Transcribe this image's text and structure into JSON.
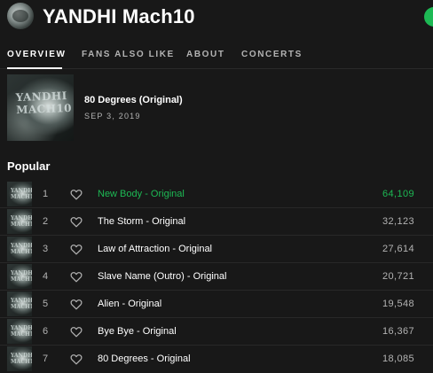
{
  "artist": {
    "name": "YANDHI Mach10",
    "avatar_icon": "artist-avatar"
  },
  "tabs": [
    {
      "label": "OVERVIEW",
      "active": true
    },
    {
      "label": "FANS ALSO LIKE",
      "active": false
    },
    {
      "label": "ABOUT",
      "active": false
    },
    {
      "label": "CONCERTS",
      "active": false
    }
  ],
  "album": {
    "title": "80 Degrees (Original)",
    "date": "SEP 3, 2019",
    "art_text": "YANDHI MACH10"
  },
  "popular": {
    "heading": "Popular",
    "tracks": [
      {
        "num": "1",
        "title": "New Body - Original",
        "plays": "64,109",
        "active": true
      },
      {
        "num": "2",
        "title": "The Storm - Original",
        "plays": "32,123",
        "active": false
      },
      {
        "num": "3",
        "title": "Law of Attraction - Original",
        "plays": "27,614",
        "active": false
      },
      {
        "num": "4",
        "title": "Slave Name (Outro) - Original",
        "plays": "20,721",
        "active": false
      },
      {
        "num": "5",
        "title": "Alien - Original",
        "plays": "19,548",
        "active": false
      },
      {
        "num": "6",
        "title": "Bye Bye - Original",
        "plays": "16,367",
        "active": false
      },
      {
        "num": "7",
        "title": "80 Degrees - Original",
        "plays": "18,085",
        "active": false
      }
    ]
  },
  "colors": {
    "background": "#181818",
    "accent": "#1db954",
    "muted": "#b3b3b3",
    "divider": "#282828"
  }
}
